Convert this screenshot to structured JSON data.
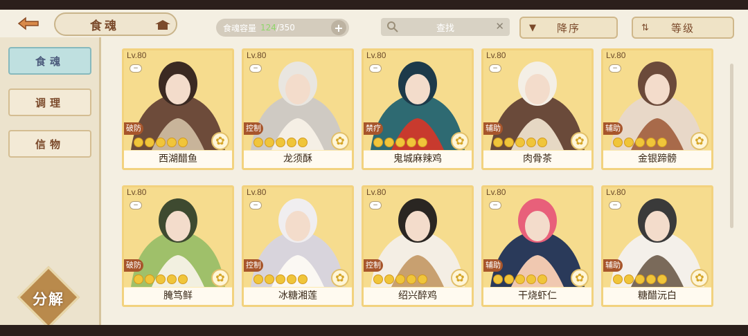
{
  "header": {
    "back_icon": "back-arrow-icon",
    "title": "食魂",
    "capacity_label": "食魂容量",
    "capacity_used": "124",
    "capacity_total": "/350",
    "capacity_plus": "+",
    "search_placeholder": "查找",
    "search_clear": "✕",
    "sort_order": "降序",
    "sort_field": "等级"
  },
  "sidebar": {
    "tabs": [
      {
        "label": "食魂",
        "active": true
      },
      {
        "label": "调理",
        "active": false
      },
      {
        "label": "信物",
        "active": false
      }
    ],
    "decompose_label": "分解"
  },
  "cards": [
    {
      "level": "Lv.80",
      "role": "破防",
      "name": "西湖醋鱼",
      "colors": [
        "#3b2a22",
        "#6d4b3a",
        "#c8b49a"
      ]
    },
    {
      "level": "Lv.80",
      "role": "控制",
      "name": "龙须酥",
      "colors": [
        "#e9e6e0",
        "#cfcac3",
        "#f5efe5"
      ]
    },
    {
      "level": "Lv.80",
      "role": "禁疗",
      "name": "鬼城麻辣鸡",
      "colors": [
        "#1d3a4a",
        "#2e6a72",
        "#c83a2e"
      ]
    },
    {
      "level": "Lv.80",
      "role": "辅助",
      "name": "肉骨茶",
      "colors": [
        "#f4efe6",
        "#6a4a3a",
        "#e6d8c4"
      ]
    },
    {
      "level": "Lv.80",
      "role": "辅助",
      "name": "金银蹄髈",
      "colors": [
        "#6b4a3a",
        "#e8d8c8",
        "#a86a4a"
      ]
    },
    {
      "level": "Lv.80",
      "role": "破防",
      "name": "腌笃鲜",
      "colors": [
        "#3e4a30",
        "#9fc06a",
        "#f2f0e0"
      ]
    },
    {
      "level": "Lv.80",
      "role": "控制",
      "name": "冰糖湘莲",
      "colors": [
        "#f0eef0",
        "#d8d4dc",
        "#fbf8f3"
      ]
    },
    {
      "level": "Lv.80",
      "role": "控制",
      "name": "绍兴醉鸡",
      "colors": [
        "#2a2622",
        "#f4eee4",
        "#c8a070"
      ]
    },
    {
      "level": "Lv.80",
      "role": "辅助",
      "name": "干烧虾仁",
      "colors": [
        "#e8607a",
        "#2a3a5a",
        "#f0c8b0"
      ]
    },
    {
      "level": "Lv.80",
      "role": "辅助",
      "name": "糖醋沅白",
      "colors": [
        "#3a3a3a",
        "#f4f0ea",
        "#7a6a5a"
      ]
    }
  ],
  "card_rarity_icon": "flower-icon",
  "card_badge_icon": "minus-icon",
  "stars_per_card": 5
}
